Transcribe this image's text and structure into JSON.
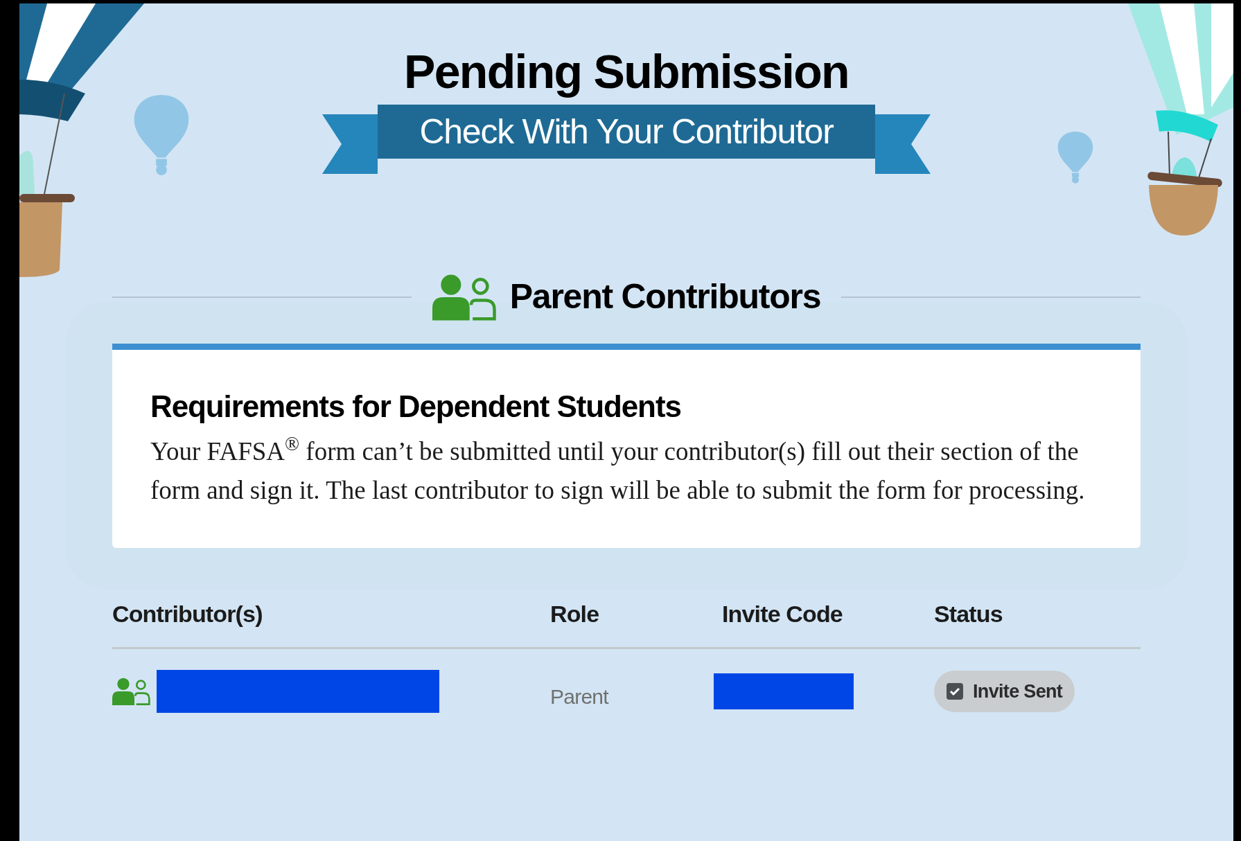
{
  "title": "Pending Submission",
  "banner": "Check With Your Contributor",
  "section": {
    "title": "Parent Contributors"
  },
  "card": {
    "heading": "Requirements for Dependent Students",
    "body": "Your FAFSA$^{®}$ form can’t be submitted until your contributor(s) fill out their section of the form and sign it. The last contributor to sign will be able to submit the form for processing."
  },
  "table": {
    "columns": [
      "Contributor(s)",
      "Role",
      "Invite Code",
      "Status"
    ],
    "rows": [
      {
        "role": "Parent",
        "status": "Invite Sent",
        "checked": true
      }
    ]
  }
}
